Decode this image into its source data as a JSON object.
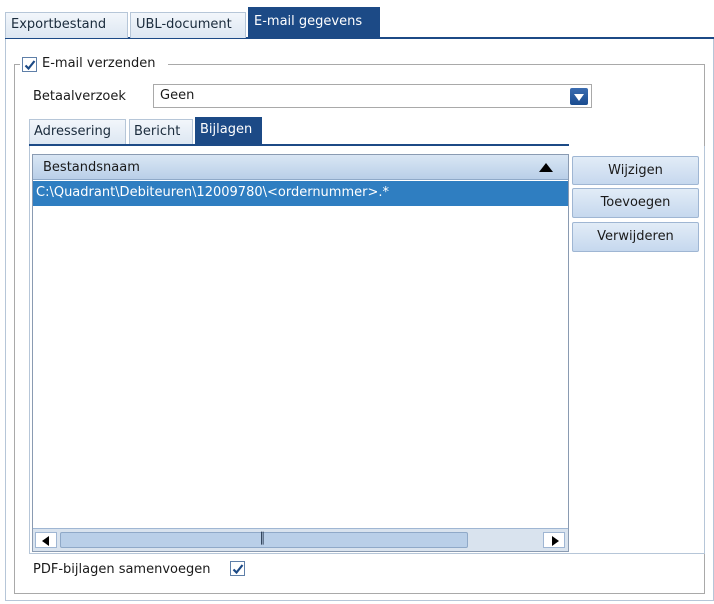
{
  "top_tabs": [
    {
      "label": "Exportbestand",
      "active": false
    },
    {
      "label": "UBL-document",
      "active": false
    },
    {
      "label": "E-mail gegevens",
      "active": true
    }
  ],
  "email_group": {
    "checkbox_label": "E-mail verzenden",
    "checked": true
  },
  "payment_request": {
    "label": "Betaalverzoek",
    "value": "Geen"
  },
  "sub_tabs": [
    {
      "label": "Adressering",
      "active": false
    },
    {
      "label": "Bericht",
      "active": false
    },
    {
      "label": "Bijlagen",
      "active": true
    }
  ],
  "attachments": {
    "column_header": "Bestandsnaam",
    "sort": "ascending",
    "rows": [
      "C:\\Quadrant\\Debiteuren\\12009780\\<ordernummer>.*"
    ],
    "scroll_thumb_glyph": "║"
  },
  "buttons": {
    "edit": "Wijzigen",
    "add": "Toevoegen",
    "delete": "Verwijderen"
  },
  "pdf_merge": {
    "label": "PDF-bijlagen samenvoegen",
    "checked": true
  },
  "colors": {
    "accent": "#1c4a86",
    "selection": "#2f7ec1"
  }
}
